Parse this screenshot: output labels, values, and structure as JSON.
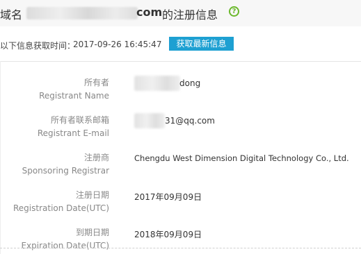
{
  "header": {
    "prefix": "域名",
    "domain_suffix": "com",
    "suffix": "的注册信息",
    "help_glyph": "?"
  },
  "fetch": {
    "label": "以下信息获取时间：",
    "time": "2017-09-26 16:45:47",
    "refresh_label": "获取最新信息"
  },
  "rows": [
    {
      "label_zh": "所有者",
      "label_en": "Registrant Name",
      "value": "dong"
    },
    {
      "label_zh": "所有者联系邮箱",
      "label_en": "Registrant E-mail",
      "value": "31@qq.com"
    },
    {
      "label_zh": "注册商",
      "label_en": "Sponsoring Registrar",
      "value": "Chengdu West Dimension Digital Technology Co., Ltd."
    },
    {
      "label_zh": "注册日期",
      "label_en": "Registration Date(UTC)",
      "value": "2017年09月09日"
    },
    {
      "label_zh": "到期日期",
      "label_en": "Expiration Date(UTC)",
      "value": "2018年09月09日"
    }
  ],
  "colors": {
    "accent_button": "#1ea0d2",
    "help_icon": "#6ab82a",
    "header_bg": "#f7f7f7"
  }
}
